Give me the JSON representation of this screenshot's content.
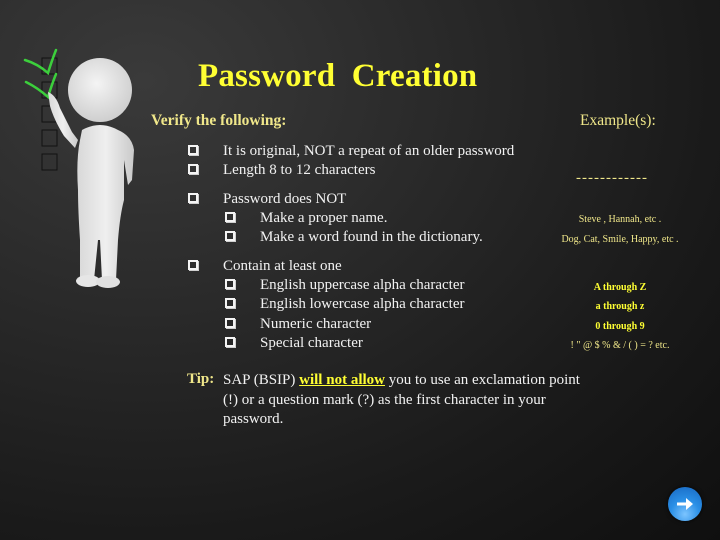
{
  "slide": {
    "title": "Password  Creation",
    "verify_heading": "Verify the following:",
    "examples_heading": "Example(s):"
  },
  "criteria": [
    {
      "label": "It is original, NOT a repeat of an older password",
      "level": 1
    },
    {
      "label": "Length 8 to 12 characters",
      "level": 1
    },
    {
      "label": "Password does NOT",
      "level": 1
    },
    {
      "label": "Make a proper name.",
      "level": 2
    },
    {
      "label": "Make a word found in the dictionary.",
      "level": 2
    },
    {
      "label": "Contain at least one",
      "level": 1
    },
    {
      "label": "English uppercase alpha character",
      "level": 2
    },
    {
      "label": "English lowercase alpha character",
      "level": 2
    },
    {
      "label": "Numeric character",
      "level": 2
    },
    {
      "label": "Special character",
      "level": 2
    }
  ],
  "examples": {
    "length": "------------",
    "proper_name": "Steve , Hannah, etc .",
    "dictionary_word": "Dog, Cat, Smile, Happy, etc .",
    "uppercase": "A through Z",
    "lowercase": "a through z",
    "numeric": "0 through 9",
    "special": "! \" @ $ % & / ( ) = ? etc."
  },
  "tip": {
    "label": "Tip:",
    "text_before": "SAP (BSIP) ",
    "emphasis": "will not allow",
    "text_after": " you to use an exclamation point (!) or a question mark (?) as the first character in your password."
  },
  "illustration": {
    "icon": "figure-with-checklist-icon",
    "checked_boxes": 2,
    "total_boxes": 5
  },
  "navigation": {
    "next_icon": "arrow-right-icon"
  },
  "colors": {
    "title": "#ffff33",
    "heading": "#f0e78a",
    "body_text": "#f2f2f2",
    "check_green": "#3ccf3c",
    "nav_button": "#2a8fe6"
  }
}
